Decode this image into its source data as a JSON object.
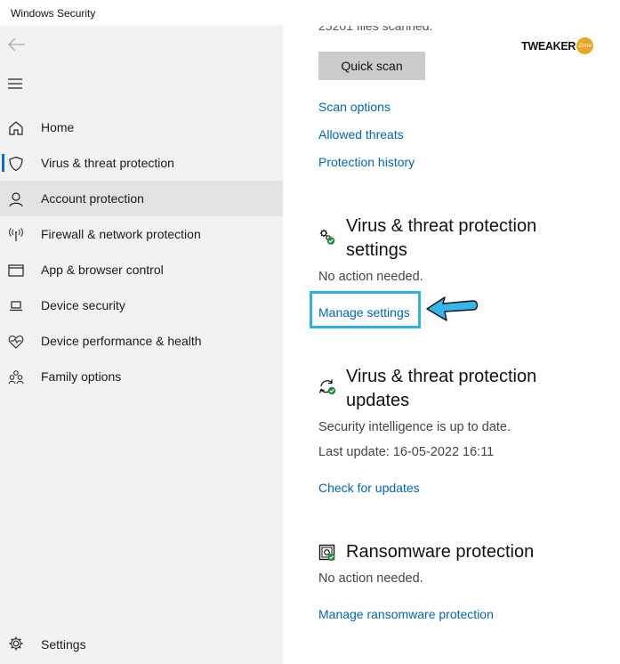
{
  "window": {
    "title": "Windows Security"
  },
  "sidebar": {
    "back_icon": "back-arrow-icon",
    "menu_icon": "hamburger-menu-icon",
    "items": [
      {
        "label": "Home",
        "icon": "home-icon",
        "selected": false,
        "hovered": false
      },
      {
        "label": "Virus & threat protection",
        "icon": "shield-icon",
        "selected": true,
        "hovered": false
      },
      {
        "label": "Account protection",
        "icon": "person-icon",
        "selected": false,
        "hovered": true
      },
      {
        "label": "Firewall & network protection",
        "icon": "wifi-antenna-icon",
        "selected": false,
        "hovered": false
      },
      {
        "label": "App & browser control",
        "icon": "browser-window-icon",
        "selected": false,
        "hovered": false
      },
      {
        "label": "Device security",
        "icon": "laptop-icon",
        "selected": false,
        "hovered": false
      },
      {
        "label": "Device performance & health",
        "icon": "heart-pulse-icon",
        "selected": false,
        "hovered": false
      },
      {
        "label": "Family options",
        "icon": "family-icon",
        "selected": false,
        "hovered": false
      }
    ],
    "settings": {
      "label": "Settings",
      "icon": "gear-icon"
    }
  },
  "main": {
    "files_scanned": "25201 files scanned.",
    "quick_scan_label": "Quick scan",
    "links": {
      "scan_options": "Scan options",
      "allowed_threats": "Allowed threats",
      "protection_history": "Protection history"
    },
    "settings_section": {
      "icon": "gears-check-icon",
      "title_line1": "Virus & threat protection",
      "title_line2": "settings",
      "status": "No action needed.",
      "link": "Manage settings"
    },
    "updates_section": {
      "icon": "refresh-check-icon",
      "title_line1": "Virus & threat protection",
      "title_line2": "updates",
      "status": "Security intelligence is up to date.",
      "last_update": "Last update: 16-05-2022 16:11",
      "link": "Check for updates"
    },
    "ransomware_section": {
      "icon": "ransomware-vault-icon",
      "title": "Ransomware protection",
      "status": "No action needed.",
      "link": "Manage ransomware protection"
    }
  },
  "annotation": {
    "highlight_color": "#2db2e6",
    "arrow_color": "#37b6ea"
  },
  "watermark": {
    "word": "TWEAKER",
    "badge": "Zone",
    "badge_color": "#e8a627"
  },
  "colors": {
    "link": "#0067b8",
    "accent": "#0a6ed1",
    "sidebar_bg": "#f2f2f2",
    "hover_bg": "#e3e3e3",
    "check_green": "#1e8c3a"
  }
}
